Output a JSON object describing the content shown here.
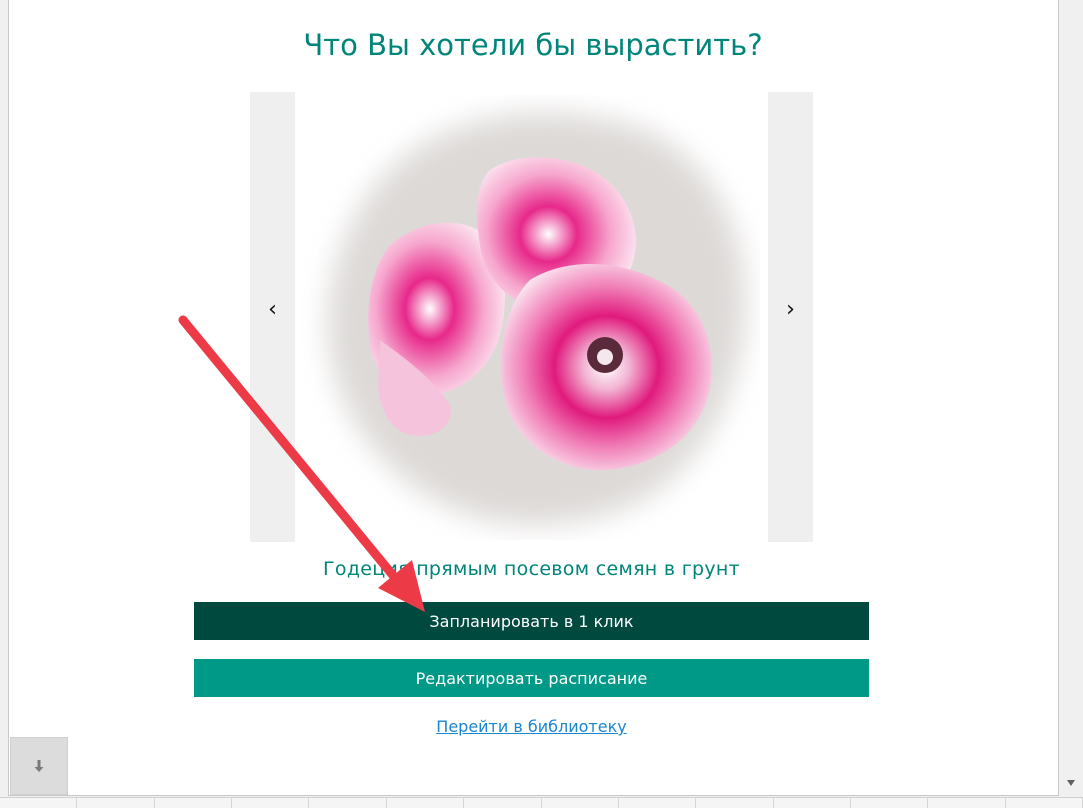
{
  "page": {
    "title": "Что Вы хотели бы вырастить?"
  },
  "carousel": {
    "prev_label": "‹",
    "next_label": "›",
    "current_plant": "Годеция прямым посевом семян в грунт"
  },
  "actions": {
    "plan_one_click": "Запланировать в 1 клик",
    "edit_schedule": "Редактировать расписание",
    "go_to_library": "Перейти в библиотеку"
  },
  "icons": {
    "scroll_down": "down-arrow-icon",
    "float_down": "down-arrow-icon"
  },
  "colors": {
    "accent": "#00857a",
    "primary_button": "#00493f",
    "secondary_button": "#009987",
    "link": "#1a86d0",
    "annotation_arrow": "#ec3b47"
  }
}
